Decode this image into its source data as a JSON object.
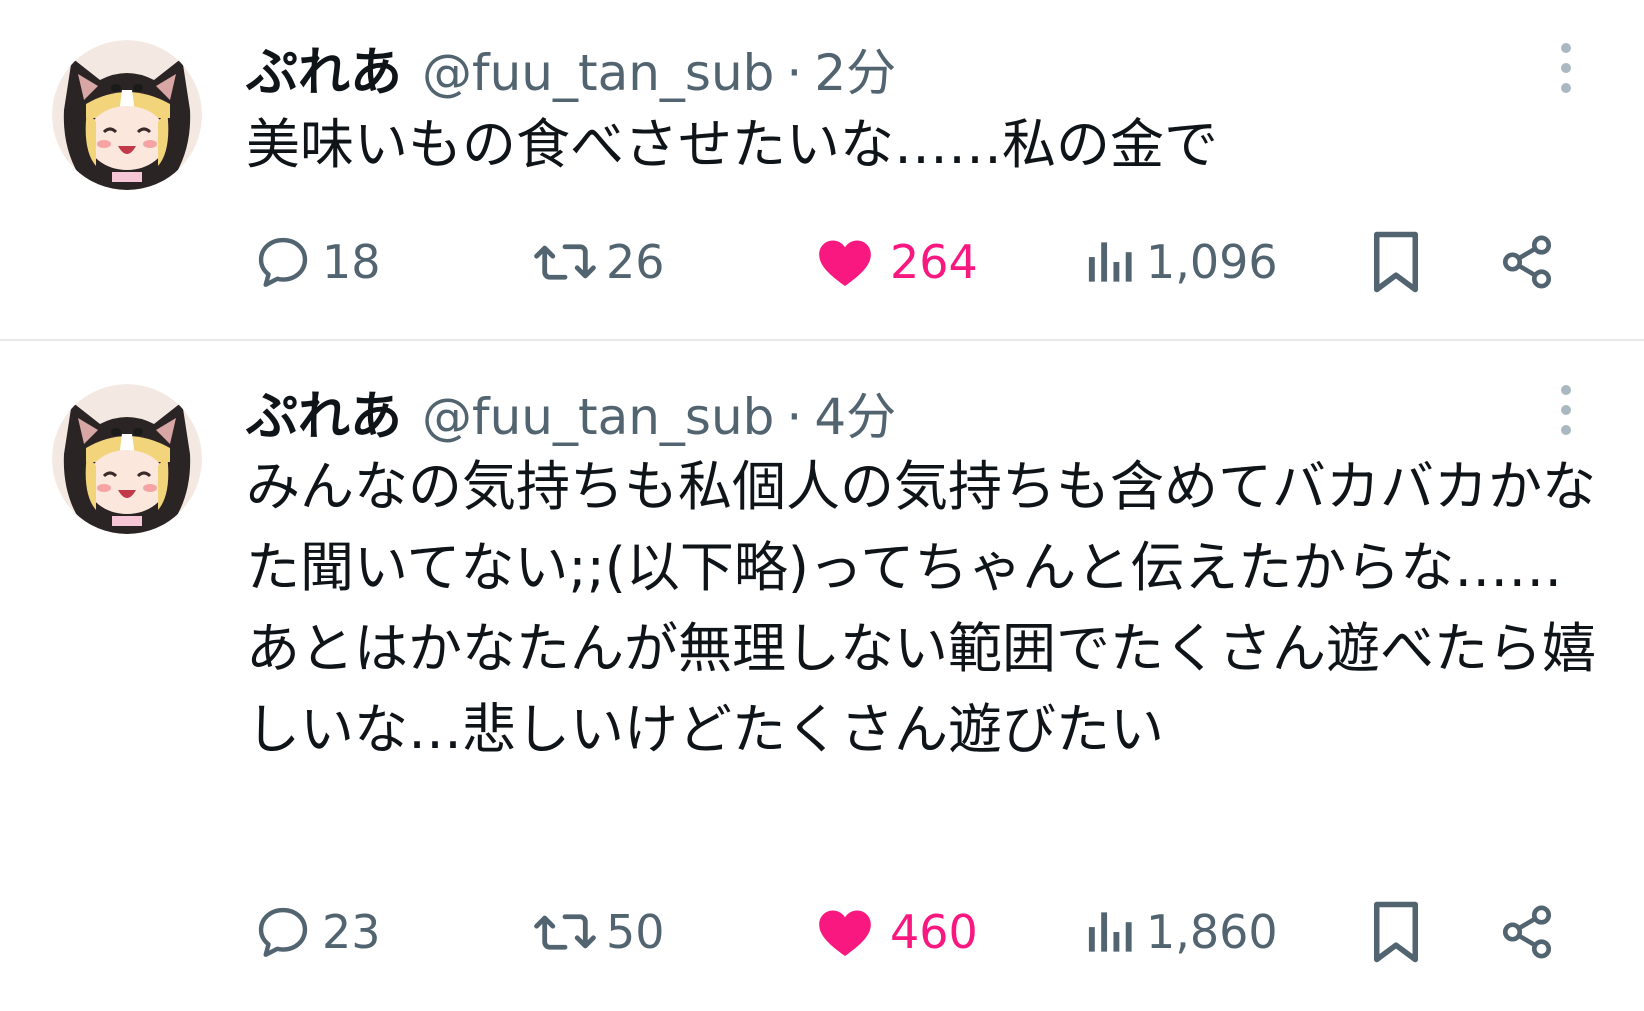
{
  "colors": {
    "like_active": "#f91880",
    "secondary_text": "#536471",
    "primary_text": "#0f1419"
  },
  "tweets": [
    {
      "display_name": "ぷれあ",
      "handle": "@fuu_tan_sub",
      "separator": "·",
      "time": "2分",
      "text": "美味いもの食べさせたいな……私の金で",
      "reply_count": "18",
      "retweet_count": "26",
      "like_count": "264",
      "view_count": "1,096",
      "liked": true
    },
    {
      "display_name": "ぷれあ",
      "handle": "@fuu_tan_sub",
      "separator": "·",
      "time": "4分",
      "text": "みんなの気持ちも私個人の気持ちも含めてバカバカかなた聞いてない;;(以下略)ってちゃんと伝えたからな……あとはかなたんが無理しない範囲でたくさん遊べたら嬉しいな…悲しいけどたくさん遊びたい",
      "reply_count": "23",
      "retweet_count": "50",
      "like_count": "460",
      "view_count": "1,860",
      "liked": true
    }
  ]
}
